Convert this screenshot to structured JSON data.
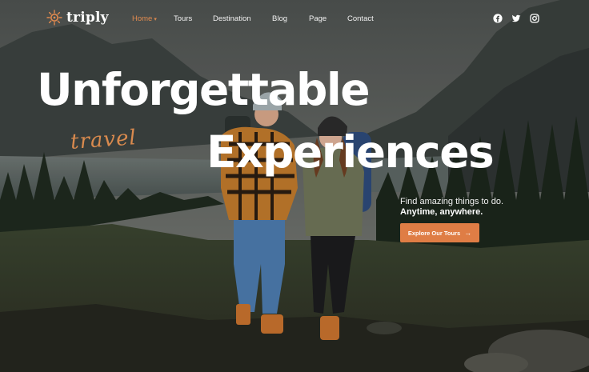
{
  "brand": {
    "name": "triply",
    "logo_icon": "sun-mandala-icon",
    "accent": "#df7d45"
  },
  "nav": {
    "items": [
      {
        "label": "Home",
        "active": true,
        "dropdown": true
      },
      {
        "label": "Tours",
        "active": false,
        "dropdown": false
      },
      {
        "label": "Destination",
        "active": false,
        "dropdown": false
      },
      {
        "label": "Blog",
        "active": false,
        "dropdown": false
      },
      {
        "label": "Page",
        "active": false,
        "dropdown": false
      },
      {
        "label": "Contact",
        "active": false,
        "dropdown": false
      }
    ],
    "socials": [
      "facebook-icon",
      "twitter-icon",
      "instagram-icon"
    ]
  },
  "hero": {
    "line1": "Unforgettable",
    "script": "travel",
    "line2": "Experiences",
    "subtitle": "Find amazing things to do.",
    "subtitle_bold": "Anytime, anywhere.",
    "cta_label": "Explore Our Tours",
    "cta_icon": "arrow-right-icon"
  }
}
